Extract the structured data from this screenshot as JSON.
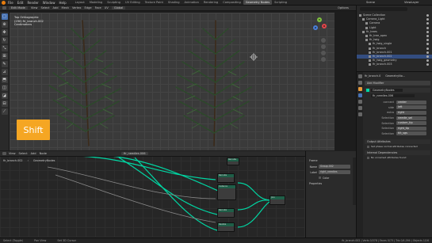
{
  "app": {
    "menus": [
      "File",
      "Edit",
      "Render",
      "Window",
      "Help"
    ],
    "workspaces": [
      "Layout",
      "Modeling",
      "Sculpting",
      "UV Editing",
      "Texture Paint",
      "Shading",
      "Animation",
      "Rendering",
      "Compositing",
      "Geometry Nodes",
      "Scripting"
    ],
    "active_workspace": "Geometry Nodes",
    "scene": "Scene",
    "view_layer": "ViewLayer"
  },
  "viewport": {
    "mode": "Edit Mode",
    "menus": [
      "View",
      "Select",
      "Add",
      "Mesh",
      "Vertex",
      "Edge",
      "Face",
      "UV"
    ],
    "orientation": "Global",
    "options_label": "Options",
    "overlay_lines": [
      "Top Orthographic",
      "(290) fir_branch.002",
      "Centimeters"
    ],
    "key_overlay": "Shift",
    "gizmo_axes": [
      "X",
      "Y",
      "Z"
    ]
  },
  "outliner": {
    "rows": [
      {
        "label": "Scene Collection",
        "indent": 0,
        "selected": false
      },
      {
        "label": "Camera_Light",
        "indent": 1,
        "selected": false
      },
      {
        "label": "Camera",
        "indent": 2,
        "selected": false
      },
      {
        "label": "Light",
        "indent": 2,
        "selected": false
      },
      {
        "label": "fir_trees",
        "indent": 1,
        "selected": false
      },
      {
        "label": "fir_tree_apex",
        "indent": 2,
        "selected": false
      },
      {
        "label": "fir_twig",
        "indent": 2,
        "selected": false
      },
      {
        "label": "fir_twig_single",
        "indent": 3,
        "selected": false
      },
      {
        "label": "fir_branch",
        "indent": 3,
        "selected": false
      },
      {
        "label": "fir_branch.001",
        "indent": 3,
        "selected": false
      },
      {
        "label": "fir_branch.002",
        "indent": 3,
        "selected": true
      },
      {
        "label": "fir_twig_geometry",
        "indent": 3,
        "selected": false
      },
      {
        "label": "fir_branch.003",
        "indent": 3,
        "selected": false
      }
    ]
  },
  "properties": {
    "object_name": "fir_branch.0",
    "modifier_tab": "GeometryNo...",
    "add_modifier": "Add Modifier",
    "modifier_name": "GeometryNodes",
    "node_group": "fir_needles.006",
    "fields": [
      {
        "label": "connect",
        "value": "center"
      },
      {
        "label": "side",
        "value": "left"
      },
      {
        "label": "extra",
        "value": "right"
      },
      {
        "label": "Selection",
        "value": "needle_sel"
      },
      {
        "label": "Selection",
        "value": "custom_tip"
      },
      {
        "label": "Selection",
        "value": "right_tip"
      },
      {
        "label": "Selection",
        "value": "tilt_sgs"
      }
    ],
    "output_attributes": "Output Attributes",
    "checkbox_1": "Set phase normal attributes connected",
    "internal_deps": "Internal Dependencies",
    "checkbox_2": "No unnamed attributes found"
  },
  "node_editor": {
    "menus": [
      "View",
      "Select",
      "Add",
      "Node"
    ],
    "breadcrumb_object": "fir_branch.002",
    "breadcrumb_modifier": "GeometryNodes",
    "node_group": "fir_needles.006",
    "nodes": [
      {
        "title": "Reroute"
      },
      {
        "title": "Reroute"
      },
      {
        "title": "Instance"
      },
      {
        "title": "Reroute"
      },
      {
        "title": "Realize"
      },
      {
        "title": "Join"
      }
    ]
  },
  "side_panel": {
    "section": "Frame",
    "name_label": "Name",
    "name_value": "Group.002",
    "label_label": "Label",
    "label_value": "right_needles",
    "color_label": "Color",
    "properties_label": "Properties"
  },
  "status": {
    "items": [
      "Select (Toggle)",
      "Pan View",
      "Set 3D Cursor"
    ],
    "right_text": "fir_branch.002 | Verts 0/378 | Faces 0/73 | Tris 0/4,094 | Objects 1/16"
  },
  "colors": {
    "accent": "#4772b3",
    "shift_key": "#f5a623",
    "geometry_link": "#00d6a3",
    "fir_green": "#2c4a2a"
  }
}
